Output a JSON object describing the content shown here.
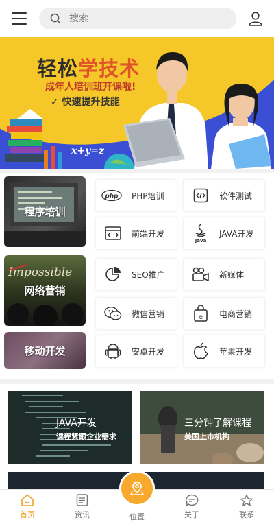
{
  "header": {
    "search_placeholder": "搜索",
    "icons": [
      "menu-icon",
      "search-icon",
      "user-icon"
    ]
  },
  "banner": {
    "title_part1": "轻松",
    "title_part2": "学技术",
    "subtitle": "成年人培训班开课啦!",
    "tagline": "✓ 快速提升技能",
    "formula": "x+y=z",
    "colors": {
      "yellow": "#f6c728",
      "blue": "#3b4fd4",
      "title_accent": "#e0542a"
    }
  },
  "categories": [
    {
      "label": "程序培训"
    },
    {
      "label": "网络营销"
    },
    {
      "label": "移动开发"
    }
  ],
  "services": [
    {
      "label": "PHP培训",
      "icon": "php-icon"
    },
    {
      "label": "软件测试",
      "icon": "code-icon"
    },
    {
      "label": "前端开发",
      "icon": "browser-code-icon"
    },
    {
      "label": "JAVA开发",
      "icon": "java-icon"
    },
    {
      "label": "SEO推广",
      "icon": "pie-chart-icon"
    },
    {
      "label": "新媒体",
      "icon": "video-camera-icon"
    },
    {
      "label": "微信营销",
      "icon": "wechat-icon"
    },
    {
      "label": "电商营销",
      "icon": "shopping-bag-icon"
    },
    {
      "label": "安卓开发",
      "icon": "android-icon"
    },
    {
      "label": "苹果开发",
      "icon": "apple-icon"
    }
  ],
  "courses": [
    {
      "title": "JAVA开发",
      "subtitle": "课程紧跟企业需求"
    },
    {
      "title": "三分钟了解课程",
      "subtitle": "美国上市机构"
    }
  ],
  "tabbar": {
    "items": [
      {
        "label": "首页",
        "icon": "home-icon",
        "active": true
      },
      {
        "label": "资讯",
        "icon": "news-icon",
        "active": false
      },
      {
        "label": "位置",
        "icon": "location-icon",
        "active": false
      },
      {
        "label": "关于",
        "icon": "chat-bubble-icon",
        "active": false
      },
      {
        "label": "联系",
        "icon": "star-icon",
        "active": false
      }
    ],
    "accent": "#f6a92c"
  }
}
